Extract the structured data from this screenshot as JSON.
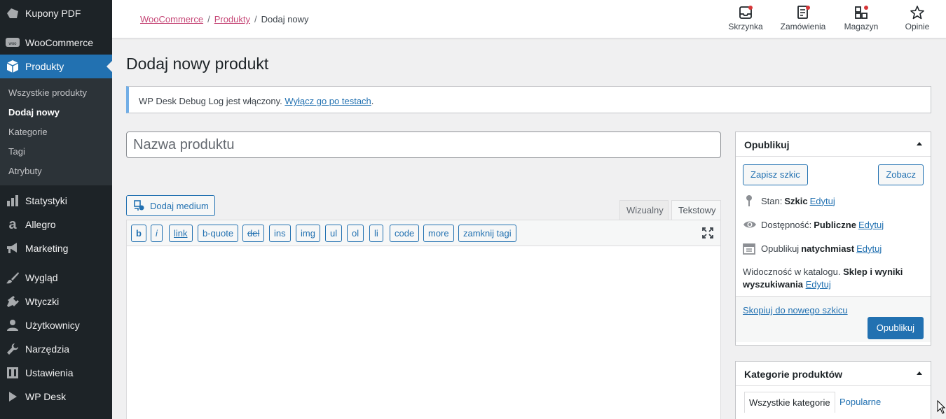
{
  "sidebar": {
    "top_items": [
      {
        "label": "Kupony PDF",
        "icon": "ticket-icon"
      },
      {
        "label": "WooCommerce",
        "icon": "woo-icon"
      },
      {
        "label": "Produkty",
        "icon": "box-icon"
      }
    ],
    "submenu": [
      "Wszystkie produkty",
      "Dodaj nowy",
      "Kategorie",
      "Tagi",
      "Atrybuty"
    ],
    "items": [
      {
        "label": "Statystyki",
        "icon": "bar-chart-icon"
      },
      {
        "label": "Allegro",
        "icon": "allegro-icon"
      },
      {
        "label": "Marketing",
        "icon": "megaphone-icon"
      },
      {
        "label": "Wygląd",
        "icon": "paintbrush-icon"
      },
      {
        "label": "Wtyczki",
        "icon": "plugin-icon"
      },
      {
        "label": "Użytkownicy",
        "icon": "user-icon"
      },
      {
        "label": "Narzędzia",
        "icon": "wrench-icon"
      },
      {
        "label": "Ustawienia",
        "icon": "settings-icon"
      },
      {
        "label": "WP Desk",
        "icon": "play-icon"
      }
    ]
  },
  "breadcrumb": {
    "woo": "WooCommerce",
    "products": "Produkty",
    "current": "Dodaj nowy",
    "sep": "/"
  },
  "toolbar": {
    "inbox": "Skrzynka",
    "orders": "Zamówienia",
    "stock": "Magazyn",
    "reviews": "Opinie"
  },
  "page_title": "Dodaj nowy produkt",
  "notice": {
    "text": "WP Desk Debug Log jest włączony. ",
    "link": "Wyłącz go po testach",
    "tail": "."
  },
  "title_field": {
    "placeholder": "Nazwa produktu"
  },
  "editor": {
    "add_media": "Dodaj medium",
    "tab_visual": "Wizualny",
    "tab_text": "Tekstowy",
    "quicktags": [
      "b",
      "i",
      "link",
      "b-quote",
      "del",
      "ins",
      "img",
      "ul",
      "ol",
      "li",
      "code",
      "more",
      "zamknij tagi"
    ]
  },
  "publish": {
    "title": "Opublikuj",
    "save_draft": "Zapisz szkic",
    "preview": "Zobacz",
    "status_label": "Stan:",
    "status_value": "Szkic",
    "visibility_label": "Dostępność:",
    "visibility_value": "Publiczne",
    "publish_label": "Opublikuj",
    "publish_value": "natychmiast",
    "edit": "Edytuj",
    "catalog_label": "Widoczność w katalogu.",
    "catalog_value": "Sklep i wyniki wyszukiwania",
    "copy_link": "Skopiuj do nowego szkicu",
    "publish_button": "Opublikuj"
  },
  "categories": {
    "title": "Kategorie produktów",
    "tab_all": "Wszystkie kategorie",
    "tab_popular": "Popularne"
  }
}
